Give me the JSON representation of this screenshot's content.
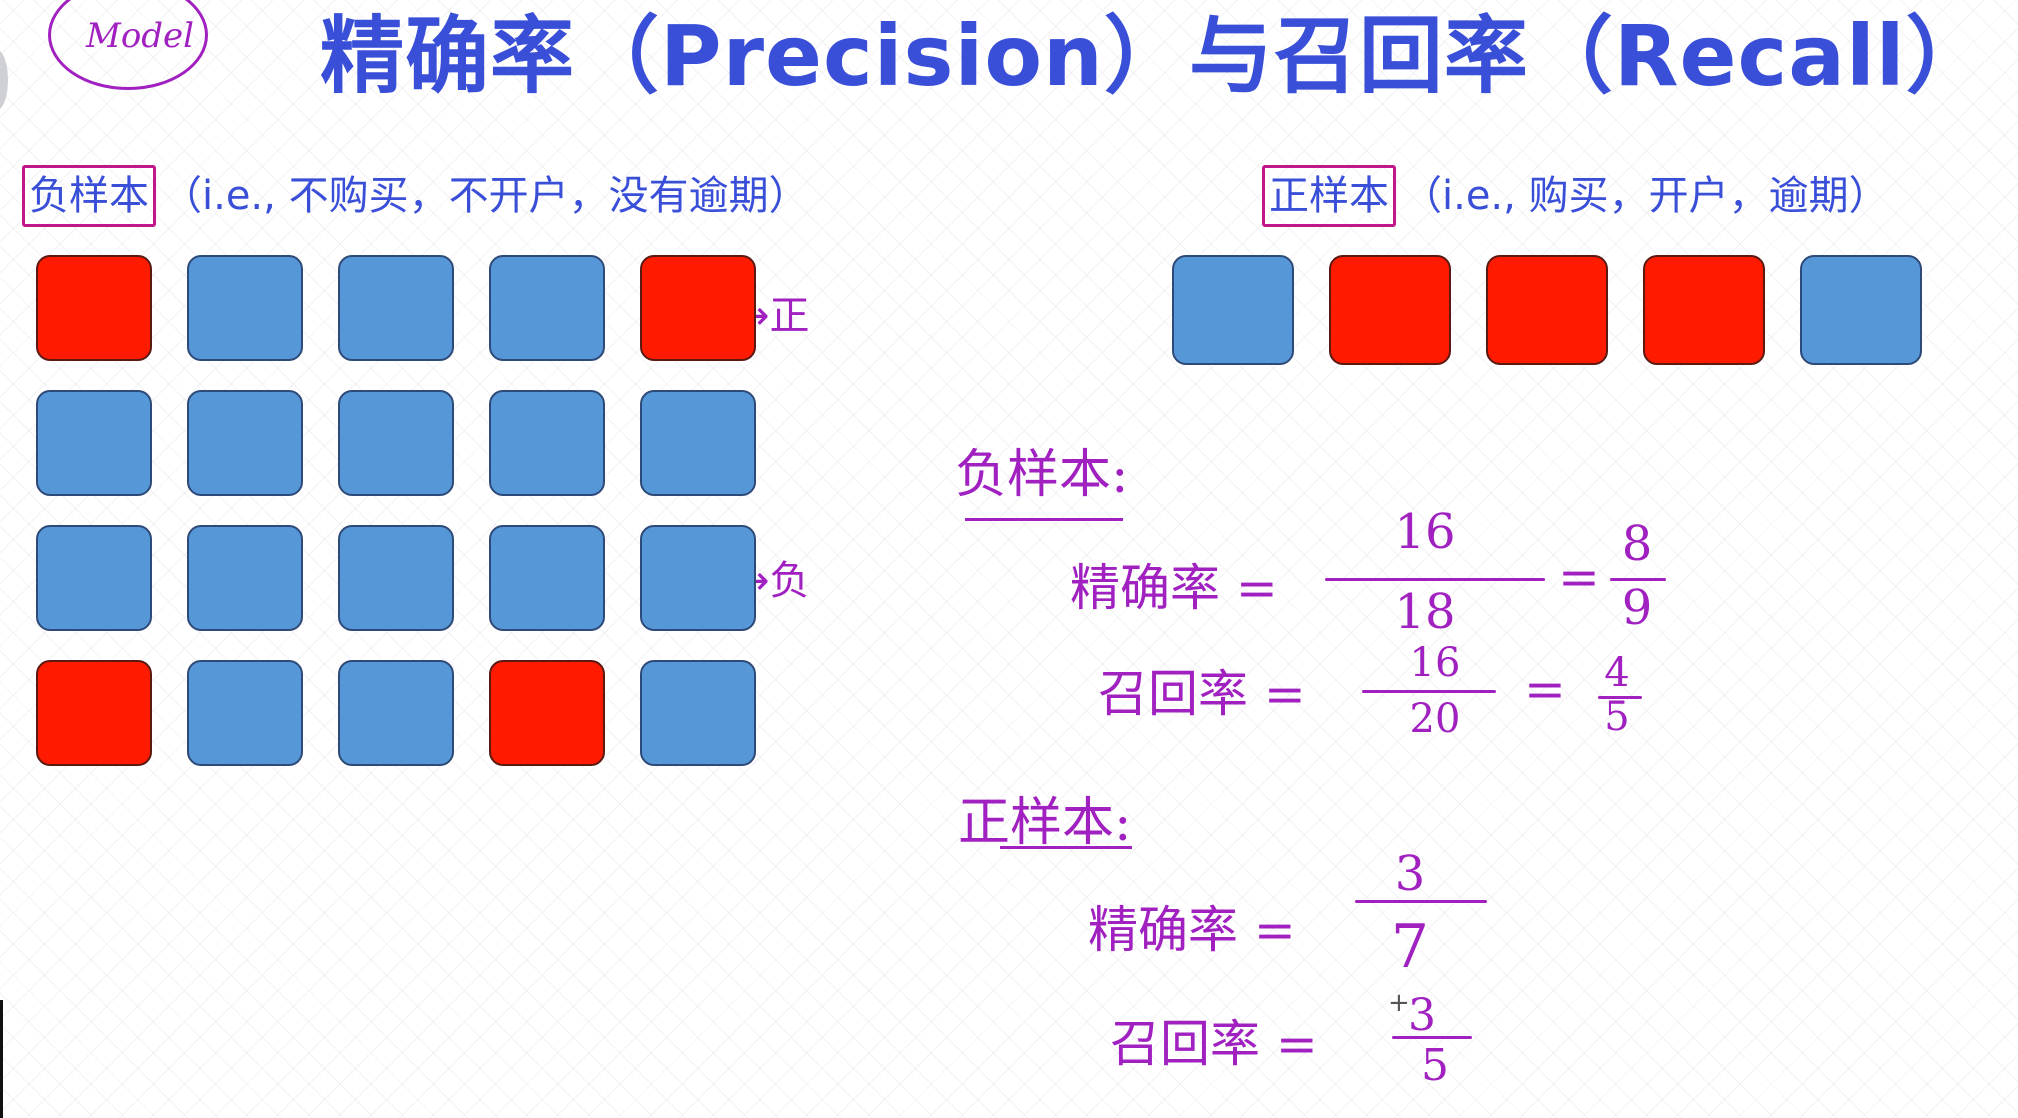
{
  "title": "精确率（Precision）与召回率（Recall）",
  "badge": "Model",
  "negative_section": {
    "key": "负样本",
    "desc": "（i.e., 不购买，不开户，没有逾期）"
  },
  "positive_section": {
    "key": "正样本",
    "desc": "（i.e., 购买，开户，逾期）"
  },
  "grid_rows": [
    [
      "red",
      "blue",
      "blue",
      "blue",
      "red"
    ],
    [
      "blue",
      "blue",
      "blue",
      "blue",
      "blue"
    ],
    [
      "blue",
      "blue",
      "blue",
      "blue",
      "blue"
    ],
    [
      "red",
      "blue",
      "blue",
      "red",
      "blue"
    ]
  ],
  "positive_row": [
    "blue",
    "red",
    "red",
    "red",
    "blue"
  ],
  "arrow_labels": {
    "to_positive": "→正",
    "to_negative": "→负"
  },
  "colors": {
    "red": "#ff1a00",
    "blue": "#5697d8",
    "title": "#3a4fd8",
    "ink": "#a020c0"
  },
  "notes": {
    "neg_heading": "负样本:",
    "pos_heading": "正样本:",
    "precision_label": "精确率 =",
    "recall_label": "召回率 =",
    "neg_precision": {
      "num": "16",
      "den": "18",
      "simp_num": "8",
      "simp_den": "9"
    },
    "neg_recall": {
      "num": "16",
      "den": "20",
      "simp_num": "4",
      "simp_den": "5"
    },
    "pos_precision": {
      "num": "3",
      "den": "7"
    },
    "pos_recall": {
      "num": "3",
      "den": "5"
    }
  }
}
